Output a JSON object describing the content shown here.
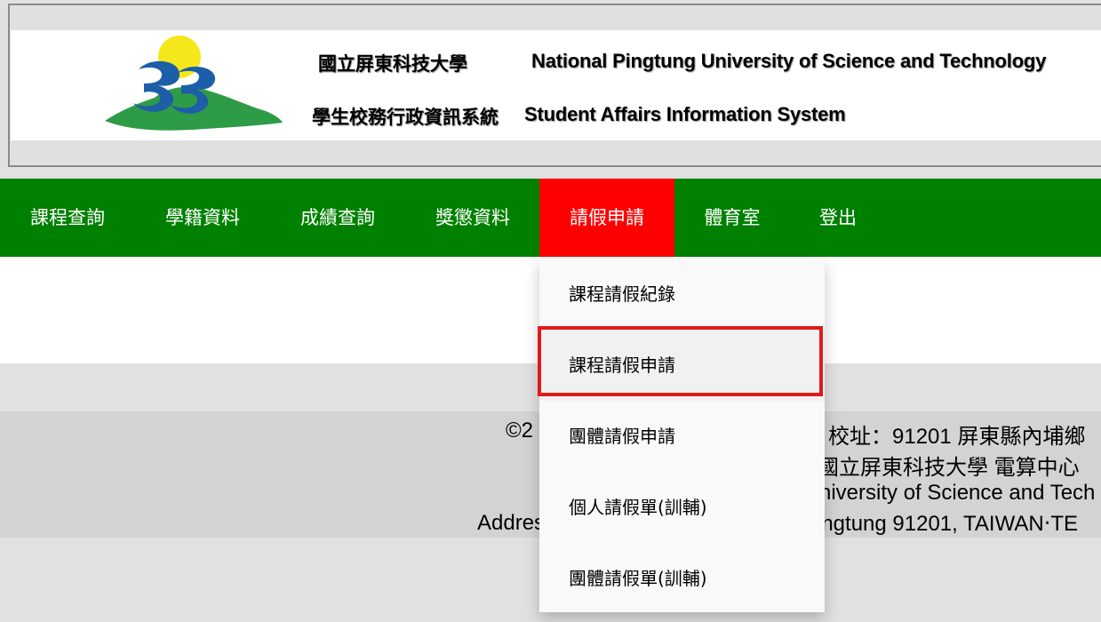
{
  "header": {
    "university_name_zh": "國立屏東科技大學",
    "university_name_en": "National Pingtung University of Science and Technology",
    "system_name_zh": "學生校務行政資訊系統",
    "system_name_en": "Student Affairs Information System"
  },
  "nav": {
    "items": [
      {
        "label": "課程查詢"
      },
      {
        "label": "學籍資料"
      },
      {
        "label": "成績查詢"
      },
      {
        "label": "獎懲資料"
      },
      {
        "label": "請假申請",
        "active": true
      },
      {
        "label": "體育室"
      },
      {
        "label": "登出"
      }
    ]
  },
  "dropdown": {
    "items": [
      {
        "label": "課程請假紀錄"
      },
      {
        "label": "課程請假申請",
        "highlighted": true
      },
      {
        "label": "團體請假申請"
      },
      {
        "label": "個人請假單(訓輔)"
      },
      {
        "label": "團體請假單(訓輔)"
      }
    ]
  },
  "footer": {
    "line1_left": "©2",
    "line1_right": "校址：91201 屏東縣內埔鄉",
    "line2_right": "國立屏東科技大學 電算中心",
    "line3_right": "niversity of Science and Tech",
    "line4_left": "Addres",
    "line4_right": "ingtung 91201, TAIWAN‧TE"
  },
  "colors": {
    "nav_bg": "#008000",
    "nav_active": "#ff0000",
    "highlight_border": "#e0191c"
  }
}
